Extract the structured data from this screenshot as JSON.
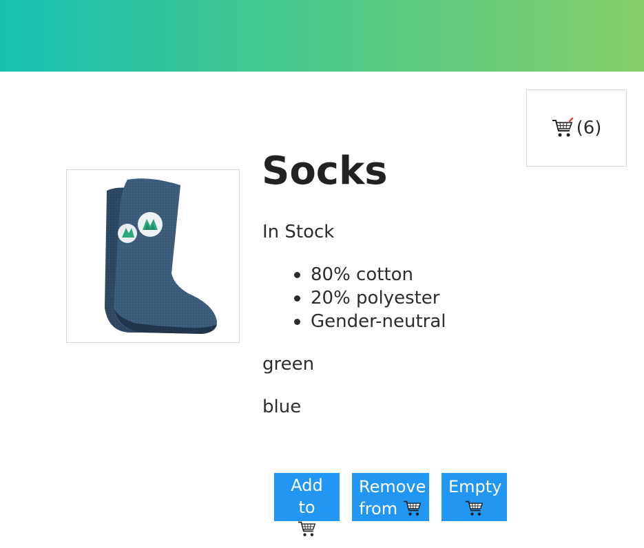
{
  "header": {
    "gradient_start": "#16c0b0",
    "gradient_end": "#84cf68"
  },
  "cart": {
    "icon": "shopping-cart-icon",
    "count_text": "(6)"
  },
  "product": {
    "image_icon": "socks-image",
    "title": "Socks",
    "stock_status": "In Stock",
    "details": [
      "80% cotton",
      "20% polyester",
      "Gender-neutral"
    ],
    "variants": [
      "green",
      "blue"
    ]
  },
  "buttons": {
    "add_line1": "Add to",
    "remove_line1": "Remove",
    "remove_line2": "from",
    "empty_line1": "Empty",
    "color": "#2196f3"
  }
}
